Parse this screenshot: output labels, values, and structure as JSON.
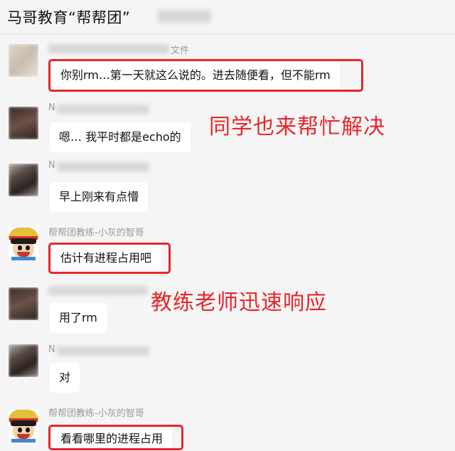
{
  "header": {
    "title": "马哥教育“帮帮团”"
  },
  "annotations": {
    "classmates_help": "同学也来帮忙解决",
    "coach_response": "教练老师迅速响应"
  },
  "messages": [
    {
      "sender": "",
      "sender_suffix": "文件",
      "text": "你别rm…第一天就这么说的。进去随便看，但不能rm",
      "highlighted": true
    },
    {
      "sender": "N",
      "sender_suffix": "",
      "text": "嗯… 我平时都是echo的",
      "highlighted": false
    },
    {
      "sender": "N",
      "sender_suffix": "",
      "text": "早上刚来有点懵",
      "highlighted": false
    },
    {
      "sender": "帮帮团教练-小灰的智哥",
      "sender_suffix": "",
      "text": "估计有进程占用吧",
      "highlighted": true
    },
    {
      "sender": "",
      "sender_suffix": "",
      "text": "用了rm",
      "highlighted": false
    },
    {
      "sender": "N",
      "sender_suffix": "",
      "text": "对",
      "highlighted": false
    },
    {
      "sender": "帮帮团教练-小灰的智哥",
      "sender_suffix": "",
      "text": "看看哪里的进程占用",
      "highlighted": true
    }
  ],
  "colors": {
    "highlight": "#e8262a",
    "bubble": "#ffffff",
    "background": "#f5f5f5",
    "sender_name": "#9a9a9a"
  },
  "icons": {
    "coach_avatar": "luffy-straw-hat-avatar"
  }
}
